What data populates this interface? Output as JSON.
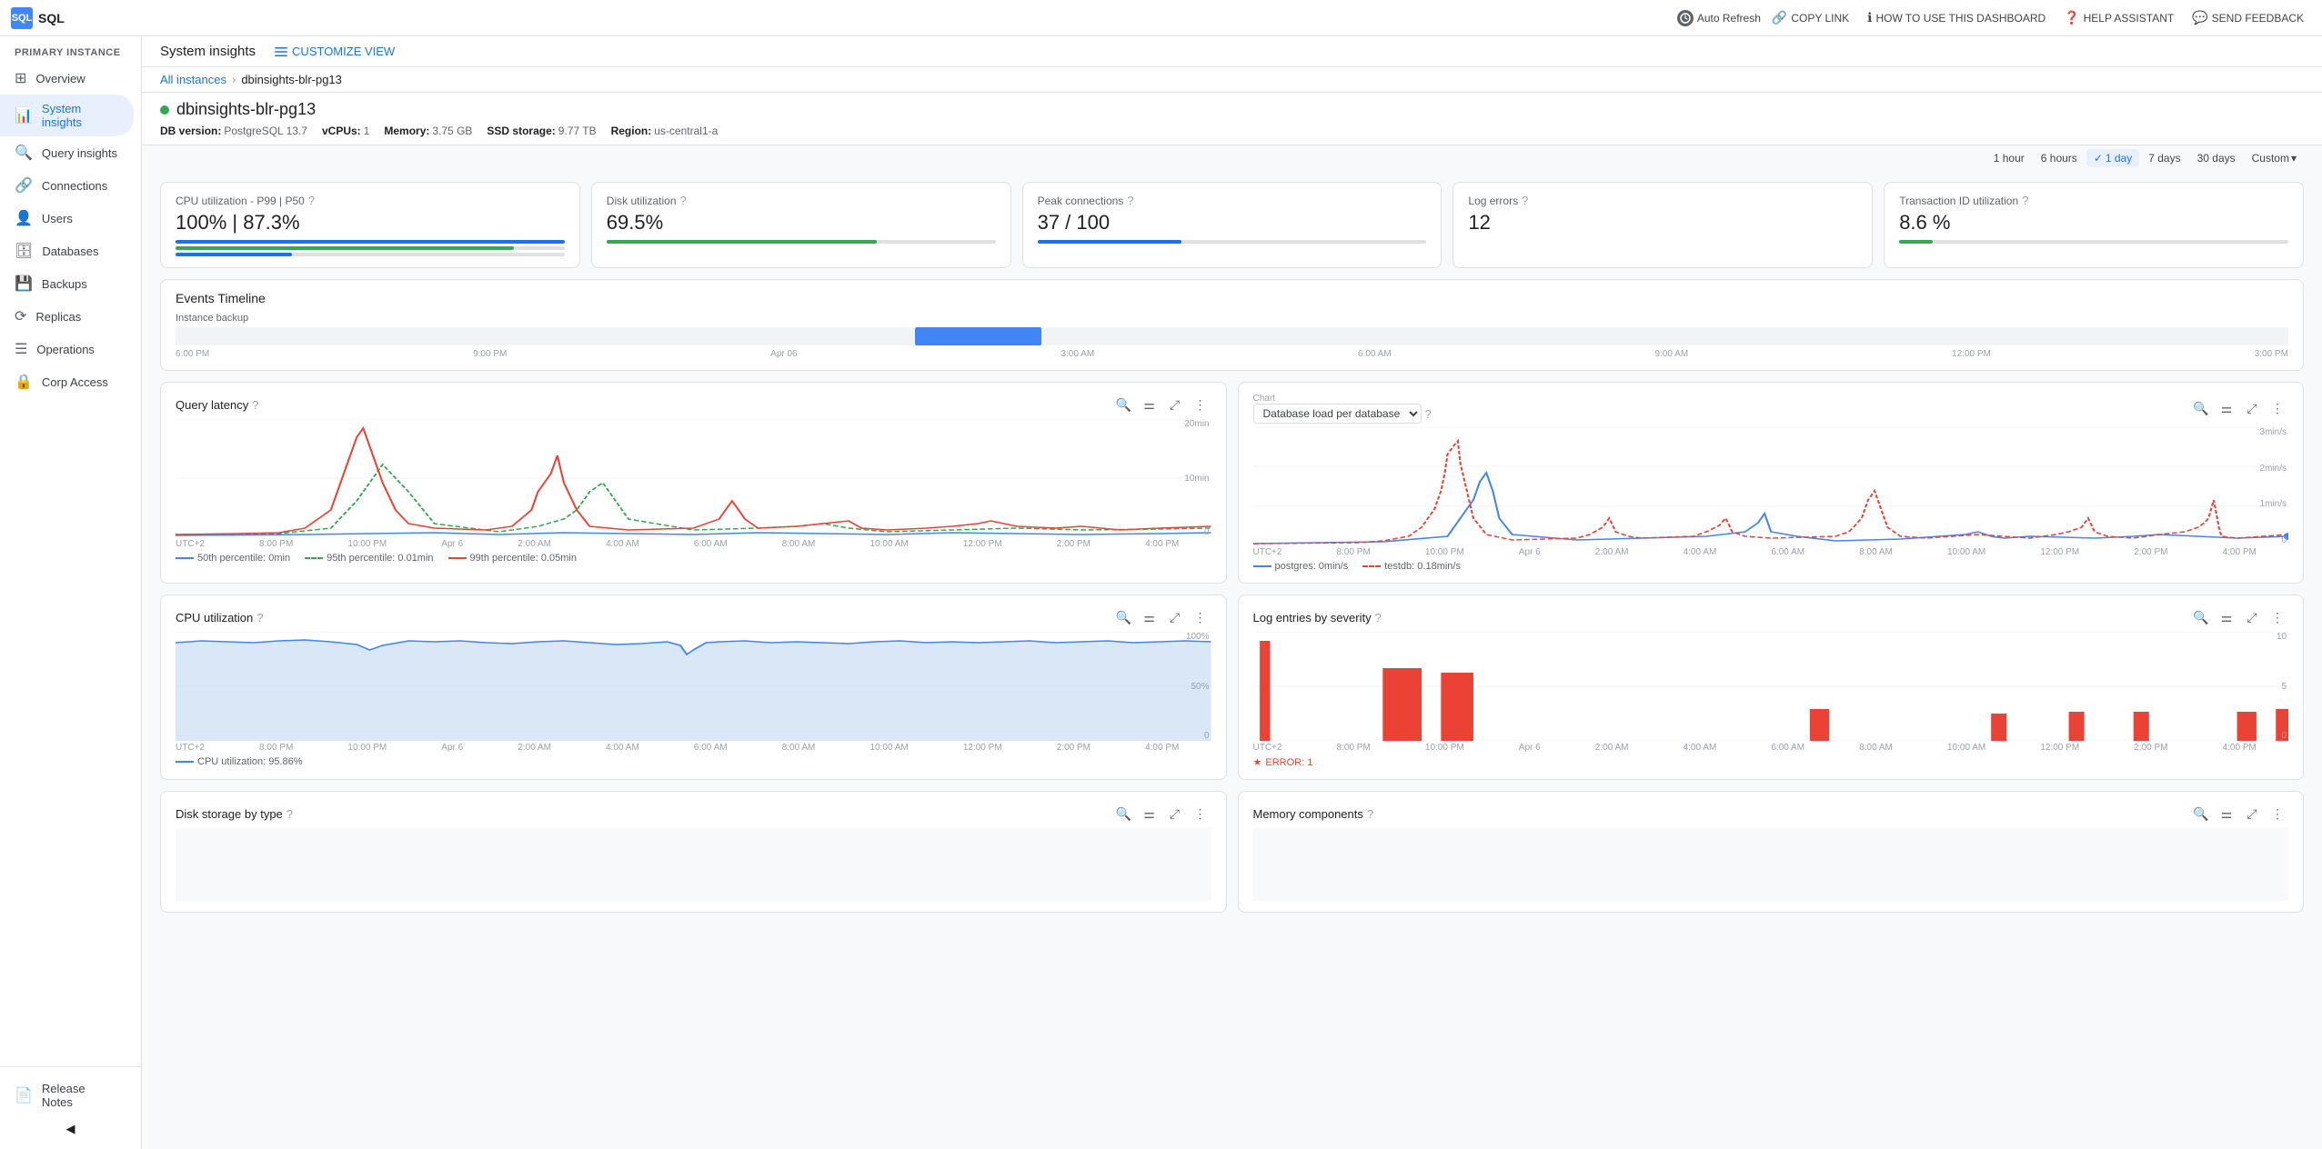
{
  "topbar": {
    "logo_text": "SQL",
    "auto_refresh_label": "Auto Refresh",
    "copy_link_label": "COPY LINK",
    "how_to_label": "HOW TO USE THIS DASHBOARD",
    "help_label": "HELP ASSISTANT",
    "feedback_label": "SEND FEEDBACK"
  },
  "sidebar": {
    "section_label": "PRIMARY INSTANCE",
    "items": [
      {
        "id": "overview",
        "label": "Overview",
        "icon": "⊞",
        "active": false
      },
      {
        "id": "system-insights",
        "label": "System insights",
        "icon": "📊",
        "active": true
      },
      {
        "id": "query-insights",
        "label": "Query insights",
        "icon": "🔍",
        "active": false
      },
      {
        "id": "connections",
        "label": "Connections",
        "icon": "🔗",
        "active": false
      },
      {
        "id": "users",
        "label": "Users",
        "icon": "👤",
        "active": false
      },
      {
        "id": "databases",
        "label": "Databases",
        "icon": "🗄",
        "active": false
      },
      {
        "id": "backups",
        "label": "Backups",
        "icon": "💾",
        "active": false
      },
      {
        "id": "replicas",
        "label": "Replicas",
        "icon": "⟳",
        "active": false
      },
      {
        "id": "operations",
        "label": "Operations",
        "icon": "☰",
        "active": false
      },
      {
        "id": "corp-access",
        "label": "Corp Access",
        "icon": "🔒",
        "active": false
      }
    ],
    "bottom_items": [
      {
        "id": "release-notes",
        "label": "Release Notes"
      }
    ]
  },
  "header": {
    "page_title": "System insights",
    "customize_label": "CUSTOMIZE VIEW",
    "breadcrumb_all": "All instances",
    "breadcrumb_instance": "dbinsights-blr-pg13",
    "instance_name": "dbinsights-blr-pg13",
    "db_version_label": "DB version:",
    "db_version": "PostgreSQL 13.7",
    "vcpus_label": "vCPUs:",
    "vcpus": "1",
    "memory_label": "Memory:",
    "memory": "3.75 GB",
    "ssd_label": "SSD storage:",
    "ssd": "9.77 TB",
    "region_label": "Region:",
    "region": "us-central1-a"
  },
  "time_selector": {
    "options": [
      "1 hour",
      "6 hours",
      "1 day",
      "7 days",
      "30 days",
      "Custom"
    ],
    "active": "1 day",
    "custom_label": "Custom"
  },
  "metrics": [
    {
      "label": "CPU utilization - P99 | P50",
      "value": "100% | 87.3%",
      "bar_fills": [
        {
          "width": "100%",
          "color": "blue"
        },
        {
          "width": "87%",
          "color": "green"
        },
        {
          "width": "30%",
          "color": "blue"
        }
      ],
      "has_bar": true
    },
    {
      "label": "Disk utilization",
      "value": "69.5%",
      "bar_fills": [
        {
          "width": "69.5%",
          "color": "green"
        }
      ],
      "has_bar": true
    },
    {
      "label": "Peak connections",
      "value": "37 / 100",
      "bar_fills": [
        {
          "width": "37%",
          "color": "blue"
        }
      ],
      "has_bar": true
    },
    {
      "label": "Log errors",
      "value": "12",
      "has_bar": false
    },
    {
      "label": "Transaction ID utilization",
      "value": "8.6 %",
      "bar_fills": [
        {
          "width": "8.6%",
          "color": "green"
        }
      ],
      "has_bar": true
    }
  ],
  "events_timeline": {
    "title": "Events Timeline",
    "event_label": "Instance backup",
    "time_labels": [
      "6:00 PM",
      "9:00 PM",
      "Apr 06",
      "3:00 AM",
      "6:00 AM",
      "9:00 AM",
      "12:00 PM",
      "3:00 PM"
    ]
  },
  "query_latency_chart": {
    "title": "Query latency",
    "y_labels": [
      "20min",
      "",
      "10min",
      "",
      "0"
    ],
    "x_labels": [
      "UTC+2",
      "8:00 PM",
      "10:00 PM",
      "Apr 6",
      "2:00 AM",
      "4:00 AM",
      "6:00 AM",
      "8:00 AM",
      "10:00 AM",
      "12:00 PM",
      "2:00 PM",
      "4:00 PM"
    ],
    "legend": [
      {
        "label": "50th percentile: 0min",
        "color": "#4285f4",
        "type": "line"
      },
      {
        "label": "95th percentile: 0.01min",
        "color": "#34a853",
        "type": "dashed"
      },
      {
        "label": "99th percentile: 0.05min",
        "color": "#ea4335",
        "type": "line"
      }
    ]
  },
  "db_load_chart": {
    "title": "Database load per database",
    "chart_label": "Chart",
    "dropdown_value": "Database load per database",
    "y_labels": [
      "3min/s",
      "2min/s",
      "1min/s",
      "0"
    ],
    "x_labels": [
      "UTC+2",
      "8:00 PM",
      "10:00 PM",
      "Apr 6",
      "2:00 AM",
      "4:00 AM",
      "6:00 AM",
      "8:00 AM",
      "10:00 AM",
      "12:00 PM",
      "2:00 PM",
      "4:00 PM"
    ],
    "legend": [
      {
        "label": "postgres: 0min/s",
        "color": "#4285f4",
        "type": "line"
      },
      {
        "label": "testdb: 0.18min/s",
        "color": "#ea4335",
        "type": "dashed"
      }
    ]
  },
  "cpu_utilization_chart": {
    "title": "CPU utilization",
    "y_labels": [
      "100%",
      "50%",
      "0"
    ],
    "x_labels": [
      "UTC+2",
      "8:00 PM",
      "10:00 PM",
      "Apr 6",
      "2:00 AM",
      "4:00 AM",
      "6:00 AM",
      "8:00 AM",
      "10:00 AM",
      "12:00 PM",
      "2:00 PM",
      "4:00 PM"
    ],
    "legend_label": "CPU utilization: 95.86%",
    "legend_color": "#4285f4"
  },
  "log_severity_chart": {
    "title": "Log entries by severity",
    "y_labels": [
      "10",
      "5",
      "0"
    ],
    "x_labels": [
      "UTC+2",
      "8:00 PM",
      "10:00 PM",
      "Apr 6",
      "2:00 AM",
      "4:00 AM",
      "6:00 AM",
      "8:00 AM",
      "10:00 AM",
      "12:00 PM",
      "2:00 PM",
      "4:00 PM"
    ],
    "error_label": "ERROR: 1"
  },
  "disk_storage_chart": {
    "title": "Disk storage by type"
  },
  "memory_components_chart": {
    "title": "Memory components"
  }
}
